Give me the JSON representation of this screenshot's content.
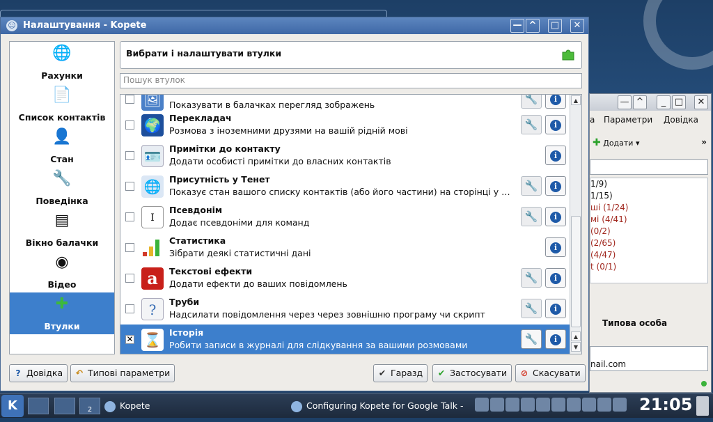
{
  "dialog": {
    "title": "Налаштування - Kopete",
    "window_buttons": {
      "menu": "—",
      "keep_above": "^",
      "maximize": "□",
      "close": "✕"
    }
  },
  "sidebar": {
    "items": [
      {
        "label": "Рахунки",
        "icon": "globe-icon",
        "glyph": "🌐"
      },
      {
        "label": "Список контактів",
        "icon": "notepad-icon",
        "glyph": "📄"
      },
      {
        "label": "Стан",
        "icon": "person-icon",
        "glyph": "👤"
      },
      {
        "label": "Поведінка",
        "icon": "wrench-icon",
        "glyph": "🔧"
      },
      {
        "label": "Вікно балачки",
        "icon": "chat-window-icon",
        "glyph": "▤"
      },
      {
        "label": "Відео",
        "icon": "webcam-icon",
        "glyph": "◉"
      },
      {
        "label": "Втулки",
        "icon": "puzzle-icon",
        "glyph": "✚"
      }
    ],
    "active": "Втулки"
  },
  "header": {
    "title": "Вибрати і налаштувати втулки",
    "icon": "puzzle-icon"
  },
  "search": {
    "placeholder": "Пошук втулок"
  },
  "plugins": [
    {
      "name": "",
      "desc": "Показувати в балачках перегляд зображень",
      "checked": false,
      "configurable": false,
      "icon": "image-preview-icon",
      "glyph": "🖼"
    },
    {
      "name": "Перекладач",
      "desc": "Розмова з іноземними друзями на вашій рідній мові",
      "checked": false,
      "configurable": false,
      "icon": "translator-icon",
      "glyph": "🌍"
    },
    {
      "name": "Примітки до контакту",
      "desc": "Додати особисті примітки до власних контактів",
      "checked": false,
      "configurable": null,
      "icon": "contact-notes-icon",
      "glyph": "🪪"
    },
    {
      "name": "Присутність у Тенет",
      "desc": "Показує стан вашого списку контактів (або його частини) на сторінці у Тенет…",
      "checked": false,
      "configurable": false,
      "icon": "web-presence-icon",
      "glyph": "🌐"
    },
    {
      "name": "Псевдонім",
      "desc": "Додає псевдоніми для команд",
      "checked": false,
      "configurable": false,
      "icon": "alias-icon",
      "glyph": "I"
    },
    {
      "name": "Статистика",
      "desc": "Зібрати деякі статистичні дані",
      "checked": false,
      "configurable": null,
      "icon": "statistics-icon",
      "glyph": "▮"
    },
    {
      "name": "Текстові ефекти",
      "desc": "Додати ефекти до ваших повідомлень",
      "checked": false,
      "configurable": false,
      "icon": "text-effects-icon",
      "glyph": "a"
    },
    {
      "name": "Труби",
      "desc": "Надсилати повідомлення через через зовнішню програму чи скрипт",
      "checked": false,
      "configurable": false,
      "icon": "pipes-icon",
      "glyph": "?"
    },
    {
      "name": "Історія",
      "desc": "Робити записи в журналі для слідкування за вашими розмовами",
      "checked": true,
      "configurable": true,
      "icon": "history-icon",
      "glyph": "⌛"
    }
  ],
  "buttons": {
    "help": "Довідка",
    "defaults": "Типові параметри",
    "ok": "Гаразд",
    "apply": "Застосувати",
    "cancel": "Скасувати"
  },
  "background_window": {
    "menu": [
      "а",
      "Параметри",
      "Довідка"
    ],
    "add_label": "Додати",
    "groups": [
      "1/9)",
      "1/15)",
      "ші (1/24)",
      "мі (4/41)",
      " (0/2)",
      " (2/65)",
      " (4/47)",
      "t (0/1)"
    ],
    "person": "Типова особа",
    "email_fragment": "nail.com"
  },
  "taskbar": {
    "tasks": [
      {
        "label": "Kopete"
      },
      {
        "label": "Configuring Kopete for Google Talk - G"
      }
    ],
    "clock": "21:05",
    "pager_number": "2"
  },
  "colors": {
    "selection": "#3d7fcc",
    "titlebar": "#4a74b2"
  }
}
